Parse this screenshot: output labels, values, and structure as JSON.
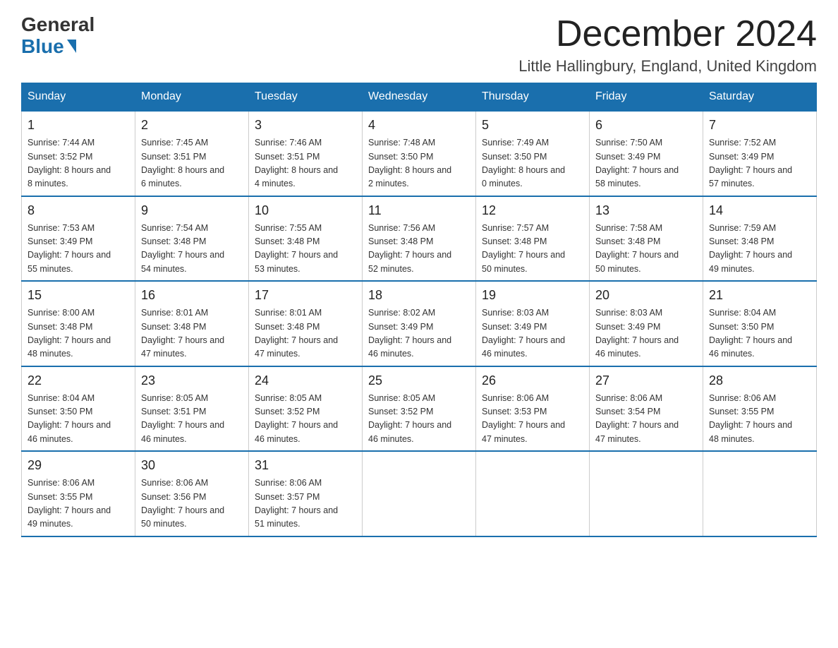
{
  "header": {
    "logo_general": "General",
    "logo_blue": "Blue",
    "month_title": "December 2024",
    "location": "Little Hallingbury, England, United Kingdom"
  },
  "weekdays": [
    "Sunday",
    "Monday",
    "Tuesday",
    "Wednesday",
    "Thursday",
    "Friday",
    "Saturday"
  ],
  "weeks": [
    [
      {
        "day": "1",
        "sunrise": "7:44 AM",
        "sunset": "3:52 PM",
        "daylight": "8 hours and 8 minutes."
      },
      {
        "day": "2",
        "sunrise": "7:45 AM",
        "sunset": "3:51 PM",
        "daylight": "8 hours and 6 minutes."
      },
      {
        "day": "3",
        "sunrise": "7:46 AM",
        "sunset": "3:51 PM",
        "daylight": "8 hours and 4 minutes."
      },
      {
        "day": "4",
        "sunrise": "7:48 AM",
        "sunset": "3:50 PM",
        "daylight": "8 hours and 2 minutes."
      },
      {
        "day": "5",
        "sunrise": "7:49 AM",
        "sunset": "3:50 PM",
        "daylight": "8 hours and 0 minutes."
      },
      {
        "day": "6",
        "sunrise": "7:50 AM",
        "sunset": "3:49 PM",
        "daylight": "7 hours and 58 minutes."
      },
      {
        "day": "7",
        "sunrise": "7:52 AM",
        "sunset": "3:49 PM",
        "daylight": "7 hours and 57 minutes."
      }
    ],
    [
      {
        "day": "8",
        "sunrise": "7:53 AM",
        "sunset": "3:49 PM",
        "daylight": "7 hours and 55 minutes."
      },
      {
        "day": "9",
        "sunrise": "7:54 AM",
        "sunset": "3:48 PM",
        "daylight": "7 hours and 54 minutes."
      },
      {
        "day": "10",
        "sunrise": "7:55 AM",
        "sunset": "3:48 PM",
        "daylight": "7 hours and 53 minutes."
      },
      {
        "day": "11",
        "sunrise": "7:56 AM",
        "sunset": "3:48 PM",
        "daylight": "7 hours and 52 minutes."
      },
      {
        "day": "12",
        "sunrise": "7:57 AM",
        "sunset": "3:48 PM",
        "daylight": "7 hours and 50 minutes."
      },
      {
        "day": "13",
        "sunrise": "7:58 AM",
        "sunset": "3:48 PM",
        "daylight": "7 hours and 50 minutes."
      },
      {
        "day": "14",
        "sunrise": "7:59 AM",
        "sunset": "3:48 PM",
        "daylight": "7 hours and 49 minutes."
      }
    ],
    [
      {
        "day": "15",
        "sunrise": "8:00 AM",
        "sunset": "3:48 PM",
        "daylight": "7 hours and 48 minutes."
      },
      {
        "day": "16",
        "sunrise": "8:01 AM",
        "sunset": "3:48 PM",
        "daylight": "7 hours and 47 minutes."
      },
      {
        "day": "17",
        "sunrise": "8:01 AM",
        "sunset": "3:48 PM",
        "daylight": "7 hours and 47 minutes."
      },
      {
        "day": "18",
        "sunrise": "8:02 AM",
        "sunset": "3:49 PM",
        "daylight": "7 hours and 46 minutes."
      },
      {
        "day": "19",
        "sunrise": "8:03 AM",
        "sunset": "3:49 PM",
        "daylight": "7 hours and 46 minutes."
      },
      {
        "day": "20",
        "sunrise": "8:03 AM",
        "sunset": "3:49 PM",
        "daylight": "7 hours and 46 minutes."
      },
      {
        "day": "21",
        "sunrise": "8:04 AM",
        "sunset": "3:50 PM",
        "daylight": "7 hours and 46 minutes."
      }
    ],
    [
      {
        "day": "22",
        "sunrise": "8:04 AM",
        "sunset": "3:50 PM",
        "daylight": "7 hours and 46 minutes."
      },
      {
        "day": "23",
        "sunrise": "8:05 AM",
        "sunset": "3:51 PM",
        "daylight": "7 hours and 46 minutes."
      },
      {
        "day": "24",
        "sunrise": "8:05 AM",
        "sunset": "3:52 PM",
        "daylight": "7 hours and 46 minutes."
      },
      {
        "day": "25",
        "sunrise": "8:05 AM",
        "sunset": "3:52 PM",
        "daylight": "7 hours and 46 minutes."
      },
      {
        "day": "26",
        "sunrise": "8:06 AM",
        "sunset": "3:53 PM",
        "daylight": "7 hours and 47 minutes."
      },
      {
        "day": "27",
        "sunrise": "8:06 AM",
        "sunset": "3:54 PM",
        "daylight": "7 hours and 47 minutes."
      },
      {
        "day": "28",
        "sunrise": "8:06 AM",
        "sunset": "3:55 PM",
        "daylight": "7 hours and 48 minutes."
      }
    ],
    [
      {
        "day": "29",
        "sunrise": "8:06 AM",
        "sunset": "3:55 PM",
        "daylight": "7 hours and 49 minutes."
      },
      {
        "day": "30",
        "sunrise": "8:06 AM",
        "sunset": "3:56 PM",
        "daylight": "7 hours and 50 minutes."
      },
      {
        "day": "31",
        "sunrise": "8:06 AM",
        "sunset": "3:57 PM",
        "daylight": "7 hours and 51 minutes."
      },
      null,
      null,
      null,
      null
    ]
  ],
  "labels": {
    "sunrise": "Sunrise: ",
    "sunset": "Sunset: ",
    "daylight": "Daylight: "
  }
}
